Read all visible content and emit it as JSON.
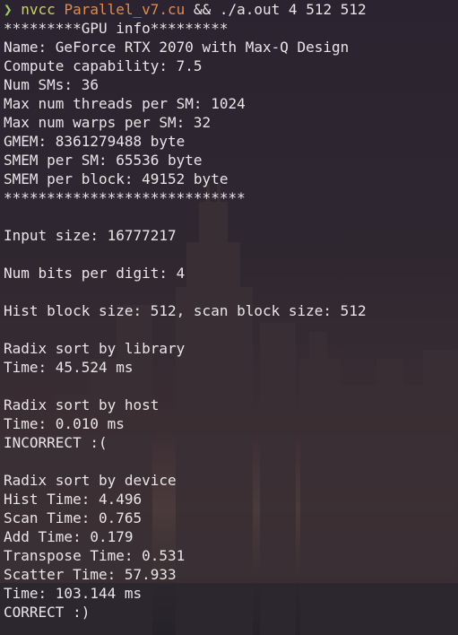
{
  "prompt": {
    "arrow": "❯",
    "command": "nvcc",
    "file": "Parallel_v7.cu",
    "operator": "&&",
    "run": "./a.out 4 512 512"
  },
  "output_lines": [
    "*********GPU info*********",
    "Name: GeForce RTX 2070 with Max-Q Design",
    "Compute capability: 7.5",
    "Num SMs: 36",
    "Max num threads per SM: 1024",
    "Max num warps per SM: 32",
    "GMEM: 8361279488 byte",
    "SMEM per SM: 65536 byte",
    "SMEM per block: 49152 byte",
    "****************************",
    "",
    "Input size: 16777217",
    "",
    "Num bits per digit: 4",
    "",
    "Hist block size: 512, scan block size: 512",
    "",
    "Radix sort by library",
    "Time: 45.524 ms",
    "",
    "Radix sort by host",
    "Time: 0.010 ms",
    "INCORRECT :(",
    "",
    "Radix sort by device",
    "Hist Time: 4.496",
    "Scan Time: 0.765",
    "Add Time: 0.179",
    "Transpose Time: 0.531",
    "Scatter Time: 57.933",
    "Time: 103.144 ms",
    "CORRECT :)"
  ],
  "colors": {
    "text": "#e9e5e6",
    "prompt_arrow": "#9bcf62",
    "command": "#c7cf6a",
    "filename": "#e08a4c"
  }
}
